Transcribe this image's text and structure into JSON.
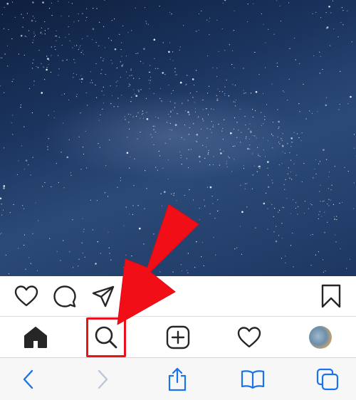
{
  "photo": {
    "subject": "starry-night-sky"
  },
  "post_actions": {
    "icons": [
      "heart-outline-icon",
      "comment-icon",
      "send-icon",
      "bookmark-icon"
    ]
  },
  "tab_bar": {
    "tabs": [
      {
        "name": "home",
        "icon": "home-filled-icon",
        "active": true
      },
      {
        "name": "search",
        "icon": "search-icon",
        "active": false,
        "highlighted": true
      },
      {
        "name": "new-post",
        "icon": "plus-square-icon",
        "active": false
      },
      {
        "name": "activity",
        "icon": "heart-outline-icon",
        "active": false
      },
      {
        "name": "profile",
        "icon": "avatar",
        "active": false
      }
    ]
  },
  "safari_toolbar": {
    "buttons": [
      {
        "name": "back",
        "icon": "chevron-left-icon",
        "enabled": true
      },
      {
        "name": "forward",
        "icon": "chevron-right-icon",
        "enabled": false
      },
      {
        "name": "share",
        "icon": "share-icon",
        "enabled": true
      },
      {
        "name": "bookmarks",
        "icon": "book-icon",
        "enabled": true
      },
      {
        "name": "tabs",
        "icon": "tabs-icon",
        "enabled": true
      }
    ],
    "accent_color": "#1a73e8",
    "disabled_color": "#b8c6d8"
  },
  "annotation": {
    "color": "#f20e16",
    "points_to": "search-tab"
  }
}
